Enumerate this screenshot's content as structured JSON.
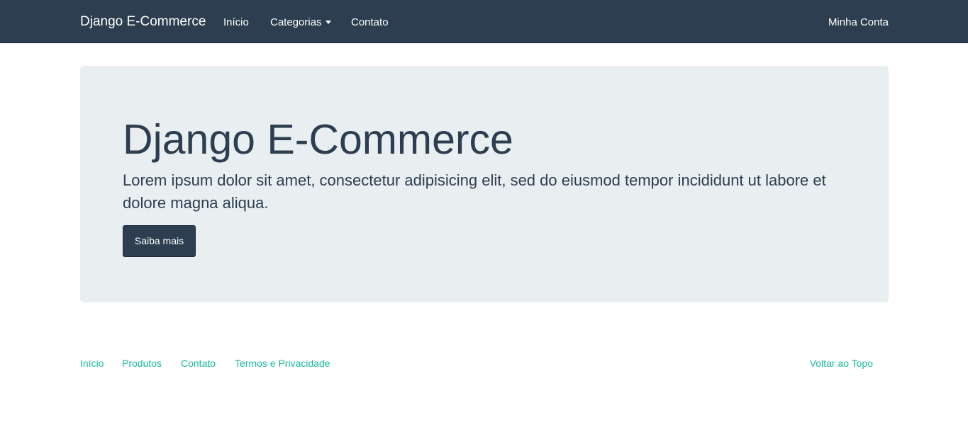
{
  "navbar": {
    "brand": "Django E-Commerce",
    "items": [
      {
        "label": "Início"
      },
      {
        "label": "Categorias"
      },
      {
        "label": "Contato"
      }
    ],
    "account": "Minha Conta"
  },
  "jumbotron": {
    "title": "Django E-Commerce",
    "text": "Lorem ipsum dolor sit amet, consectetur adipisicing elit, sed do eiusmod tempor incididunt ut labore et dolore magna aliqua.",
    "button": "Saiba mais"
  },
  "footer": {
    "links": [
      {
        "label": "Início"
      },
      {
        "label": "Produtos"
      },
      {
        "label": "Contato"
      },
      {
        "label": "Termos e Privacidade"
      }
    ],
    "back_to_top": "Voltar ao Topo"
  },
  "colors": {
    "navbar_bg": "#2c3e50",
    "jumbotron_bg": "#e9eef1",
    "link_accent": "#18bc9c",
    "text": "#2c3e50"
  },
  "icons": {
    "dropdown": "caret-down-icon"
  }
}
